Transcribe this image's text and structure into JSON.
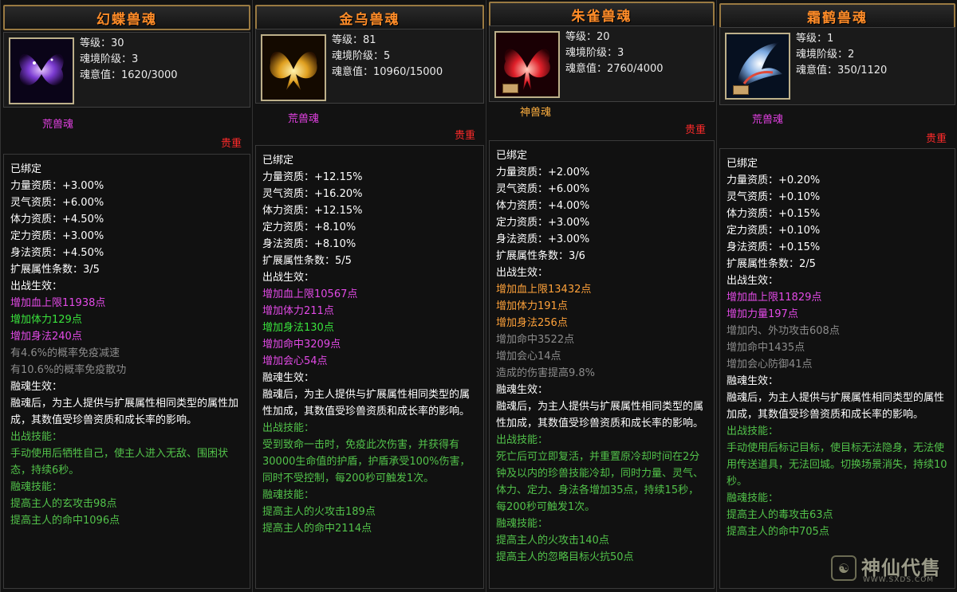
{
  "cards": [
    {
      "name": "幻蝶兽魂",
      "level": "等级：30",
      "stage": "魂境阶级：3",
      "spirit": "魂意值：1620/3000",
      "soul_type": "荒兽魂",
      "rarity": "贵重",
      "lines": [
        {
          "t": "已绑定",
          "c": "w"
        },
        {
          "t": "力量资质：+3.00%",
          "c": "w"
        },
        {
          "t": "灵气资质：+6.00%",
          "c": "w"
        },
        {
          "t": "体力资质：+4.50%",
          "c": "w"
        },
        {
          "t": "定力资质：+3.00%",
          "c": "w"
        },
        {
          "t": "身法资质：+4.50%",
          "c": "w"
        },
        {
          "t": "扩展属性条数：3/5",
          "c": "w"
        },
        {
          "t": "出战生效：",
          "c": "w"
        },
        {
          "t": "增加血上限11938点",
          "c": "m"
        },
        {
          "t": "增加体力129点",
          "c": "g"
        },
        {
          "t": "增加身法240点",
          "c": "m"
        },
        {
          "t": "有4.6%的概率免疫减速",
          "c": "gr"
        },
        {
          "t": "有10.6%的概率免疫散功",
          "c": "gr"
        },
        {
          "t": "融魂生效：",
          "c": "w"
        },
        {
          "t": "融魂后，为主人提供与扩展属性相同类型的属性加成，其数值受珍兽资质和成长率的影响。",
          "c": "w",
          "p": true
        },
        {
          "t": "出战技能：",
          "c": "gs"
        },
        {
          "t": "手动使用后牺牲自己，使主人进入无敌、围困状态，持续6秒。",
          "c": "gs",
          "p": true
        },
        {
          "t": "融魂技能：",
          "c": "gs"
        },
        {
          "t": "提高主人的玄攻击98点",
          "c": "gs"
        },
        {
          "t": "提高主人的命中1096点",
          "c": "gs"
        }
      ]
    },
    {
      "name": "金乌兽魂",
      "level": "等级：81",
      "stage": "魂境阶级：5",
      "spirit": "魂意值：10960/15000",
      "soul_type": "荒兽魂",
      "rarity": "贵重",
      "lines": [
        {
          "t": "已绑定",
          "c": "w"
        },
        {
          "t": "力量资质：+12.15%",
          "c": "w"
        },
        {
          "t": "灵气资质：+16.20%",
          "c": "w"
        },
        {
          "t": "体力资质：+12.15%",
          "c": "w"
        },
        {
          "t": "定力资质：+8.10%",
          "c": "w"
        },
        {
          "t": "身法资质：+8.10%",
          "c": "w"
        },
        {
          "t": "扩展属性条数：5/5",
          "c": "w"
        },
        {
          "t": "出战生效：",
          "c": "w"
        },
        {
          "t": "增加血上限10567点",
          "c": "m"
        },
        {
          "t": "增加体力211点",
          "c": "m"
        },
        {
          "t": "增加身法130点",
          "c": "g"
        },
        {
          "t": "增加命中3209点",
          "c": "m"
        },
        {
          "t": "增加会心54点",
          "c": "m"
        },
        {
          "t": "融魂生效：",
          "c": "w"
        },
        {
          "t": "融魂后，为主人提供与扩展属性相同类型的属性加成，其数值受珍兽资质和成长率的影响。",
          "c": "w",
          "p": true
        },
        {
          "t": "出战技能：",
          "c": "gs"
        },
        {
          "t": "受到致命一击时，免疫此次伤害，并获得有30000生命值的护盾，护盾承受100%伤害，同时不受控制，每200秒可触发1次。",
          "c": "gs",
          "p": true
        },
        {
          "t": "融魂技能：",
          "c": "gs"
        },
        {
          "t": "提高主人的火攻击189点",
          "c": "gs"
        },
        {
          "t": "提高主人的命中2114点",
          "c": "gs"
        }
      ]
    },
    {
      "name": "朱雀兽魂",
      "level": "等级：20",
      "stage": "魂境阶级：3",
      "spirit": "魂意值：2760/4000",
      "soul_type": "神兽魂",
      "rarity": "贵重",
      "lines": [
        {
          "t": "已绑定",
          "c": "w"
        },
        {
          "t": "力量资质：+2.00%",
          "c": "w"
        },
        {
          "t": "灵气资质：+6.00%",
          "c": "w"
        },
        {
          "t": "体力资质：+4.00%",
          "c": "w"
        },
        {
          "t": "定力资质：+3.00%",
          "c": "w"
        },
        {
          "t": "身法资质：+3.00%",
          "c": "w"
        },
        {
          "t": "扩展属性条数：3/6",
          "c": "w"
        },
        {
          "t": "出战生效：",
          "c": "w"
        },
        {
          "t": "增加血上限13432点",
          "c": "o"
        },
        {
          "t": "增加体力191点",
          "c": "o"
        },
        {
          "t": "增加身法256点",
          "c": "o"
        },
        {
          "t": "增加命中3522点",
          "c": "gr"
        },
        {
          "t": "增加会心14点",
          "c": "gr"
        },
        {
          "t": "造成的伤害提高9.8%",
          "c": "gr"
        },
        {
          "t": "融魂生效：",
          "c": "w"
        },
        {
          "t": "融魂后，为主人提供与扩展属性相同类型的属性加成，其数值受珍兽资质和成长率的影响。",
          "c": "w",
          "p": true
        },
        {
          "t": "出战技能：",
          "c": "gs"
        },
        {
          "t": "死亡后可立即复活，并重置原冷却时间在2分钟及以内的珍兽技能冷却，同时力量、灵气、体力、定力、身法各增加35点，持续15秒，每200秒可触发1次。",
          "c": "gs",
          "p": true
        },
        {
          "t": "融魂技能：",
          "c": "gs"
        },
        {
          "t": "提高主人的火攻击140点",
          "c": "gs"
        },
        {
          "t": "提高主人的忽略目标火抗50点",
          "c": "gs"
        }
      ]
    },
    {
      "name": "霜鹤兽魂",
      "level": "等级：1",
      "stage": "魂境阶级：2",
      "spirit": "魂意值：350/1120",
      "soul_type": "荒兽魂",
      "rarity": "贵重",
      "lines": [
        {
          "t": "已绑定",
          "c": "w"
        },
        {
          "t": "力量资质：+0.20%",
          "c": "w"
        },
        {
          "t": "灵气资质：+0.10%",
          "c": "w"
        },
        {
          "t": "体力资质：+0.15%",
          "c": "w"
        },
        {
          "t": "定力资质：+0.10%",
          "c": "w"
        },
        {
          "t": "身法资质：+0.15%",
          "c": "w"
        },
        {
          "t": "扩展属性条数：2/5",
          "c": "w"
        },
        {
          "t": "出战生效：",
          "c": "w"
        },
        {
          "t": "增加血上限11829点",
          "c": "m"
        },
        {
          "t": "增加力量197点",
          "c": "m"
        },
        {
          "t": "增加内、外功攻击608点",
          "c": "gr"
        },
        {
          "t": "增加命中1435点",
          "c": "gr"
        },
        {
          "t": "增加会心防御41点",
          "c": "gr"
        },
        {
          "t": "融魂生效：",
          "c": "w"
        },
        {
          "t": "融魂后，为主人提供与扩展属性相同类型的属性加成，其数值受珍兽资质和成长率的影响。",
          "c": "w",
          "p": true
        },
        {
          "t": "出战技能：",
          "c": "gs"
        },
        {
          "t": "手动使用后标记目标，使目标无法隐身，无法使用传送道具，无法回城。切换场景消失，持续10秒。",
          "c": "gs",
          "p": true
        },
        {
          "t": "融魂技能：",
          "c": "gs"
        },
        {
          "t": "提高主人的毒攻击63点",
          "c": "gs"
        },
        {
          "t": "提高主人的命中705点",
          "c": "gs"
        }
      ]
    }
  ],
  "watermark": {
    "text": "神仙代售",
    "url": "WWW.SXDS.COM"
  },
  "colors": {
    "title": "#ff8c28",
    "rarity": "#ff2a2a",
    "magenta": "#e24ae6",
    "green": "#39e33c",
    "gray": "#8c8c8c",
    "orange": "#ffa23a",
    "skill_green": "#52c24a"
  }
}
